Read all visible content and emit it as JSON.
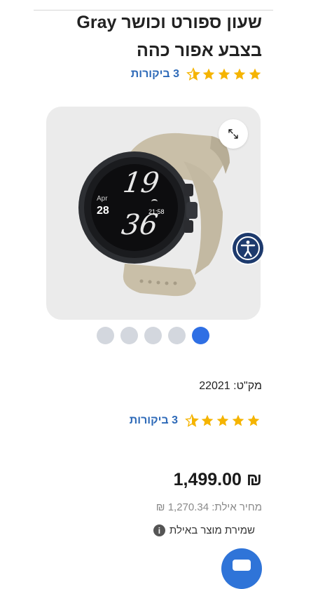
{
  "product": {
    "title": "שעון ספורט וכושר Gray בצבע אפור כהה",
    "rating": 4.5,
    "reviews_label": "3 ביקורות",
    "sku_label": "מק\"ט: 22021",
    "price": "₪ 1,499.00",
    "eilat_price": "מחיר אילת: 1,270.34 ₪",
    "save_eilat_label": "שמירת מוצר באילת"
  },
  "watch": {
    "month": "Apr",
    "day": "28",
    "hour": "19",
    "minute": "36",
    "time": "21:58"
  },
  "gallery": {
    "total_images": 5,
    "active_index": 4
  },
  "colors": {
    "star": "#f5b400",
    "link": "#2e6ab8",
    "dot_active": "#2f6fe4",
    "dot_inactive": "#d3d7de",
    "a11y": "#1d3a6d",
    "chat": "#2f74d8"
  },
  "icons": {
    "zoom": "expand-arrows-icon",
    "accessibility": "accessibility-icon",
    "info": "info-icon",
    "chat": "chat-icon",
    "star": "star-icon"
  }
}
